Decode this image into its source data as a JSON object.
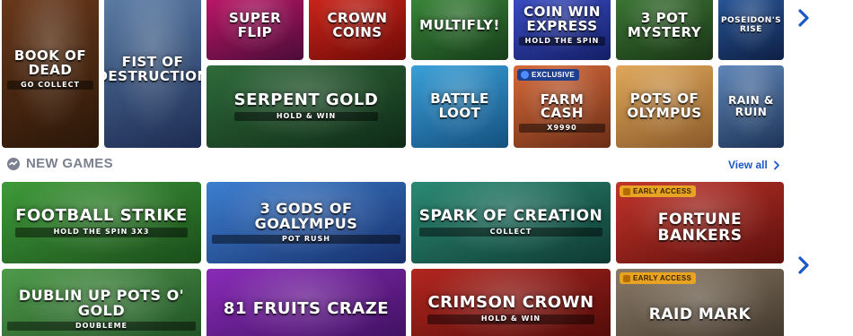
{
  "carousel_top": {
    "row1": [
      {
        "title": "Book of Dead",
        "subtitle": "GO COLLECT",
        "bg1": "#6b3a1b",
        "bg2": "#2b1708"
      },
      {
        "title": "Fist of Destruction",
        "bg1": "#5c7fa8",
        "bg2": "#1d2c52"
      },
      {
        "title": "Super Flip",
        "bg1": "#c4166b",
        "bg2": "#4a0c38"
      },
      {
        "title": "Crown Coins",
        "bg1": "#d1261a",
        "bg2": "#6e0b08"
      },
      {
        "title": "Multifly!",
        "bg1": "#3c8a3a",
        "bg2": "#163d1a"
      },
      {
        "title": "Coin Win Express",
        "subtitle": "HOLD THE SPIN",
        "bg1": "#3c4fc9",
        "bg2": "#141f66"
      },
      {
        "title": "3 Pot Mystery",
        "bg1": "#3d7a35",
        "bg2": "#1a3416"
      },
      {
        "title": "Poseidon's Rise",
        "bg1": "#2a5a9c",
        "bg2": "#0e1f45"
      }
    ],
    "row2": [
      {
        "title": "Serpent Gold",
        "subtitle": "HOLD & WIN",
        "bg1": "#2f6b3a",
        "bg2": "#0f2a17"
      },
      {
        "title": "Battle Loot",
        "bg1": "#3aa0d8",
        "bg2": "#14507f"
      },
      {
        "title": "Farm Cash",
        "subtitle": "x9990",
        "badge": "EXCLUSIVE",
        "bg1": "#d66a3a",
        "bg2": "#6b2d16"
      },
      {
        "title": "Pots of Olympus",
        "bg1": "#e0a85a",
        "bg2": "#8a5a2a"
      },
      {
        "title": "Rain & Ruin",
        "bg1": "#5f86b8",
        "bg2": "#1e3457"
      }
    ]
  },
  "new_games": {
    "title": "NEW GAMES",
    "view_all": "View all",
    "row1": [
      {
        "title": "Football Strike",
        "subtitle": "HOLD THE SPIN 3x3",
        "bg1": "#3f9b3a",
        "bg2": "#1a4d1a"
      },
      {
        "title": "3 Gods of Goalympus",
        "subtitle": "POT RUSH",
        "bg1": "#3d7fd0",
        "bg2": "#172f6a"
      },
      {
        "title": "Spark of Creation",
        "subtitle": "COLLECT",
        "bg1": "#2b8a74",
        "bg2": "#0e3a33"
      },
      {
        "title": "Fortune Bankers",
        "badge": "EARLY ACCESS",
        "bg1": "#c2342a",
        "bg2": "#5c0f0c"
      }
    ],
    "row2": [
      {
        "title": "Dublin Up Pots O' Gold",
        "subtitle": "DOUBLEME",
        "bg1": "#4f9b4a",
        "bg2": "#1d4a22"
      },
      {
        "title": "81 Fruits Craze",
        "bg1": "#8a2bb8",
        "bg2": "#3a0f5a"
      },
      {
        "title": "Crimson Crown",
        "subtitle": "HOLD & WIN",
        "bg1": "#b3261f",
        "bg2": "#4a0a08"
      },
      {
        "title": "Raid Mark",
        "badge": "EARLY ACCESS",
        "bg1": "#8a7a66",
        "bg2": "#3c3228"
      }
    ]
  },
  "icons": {
    "next_arrow": "chevron-right-icon",
    "section_icon": "new-games-icon"
  },
  "colors": {
    "accent": "#1a58c9",
    "section_title": "#7b8190"
  }
}
